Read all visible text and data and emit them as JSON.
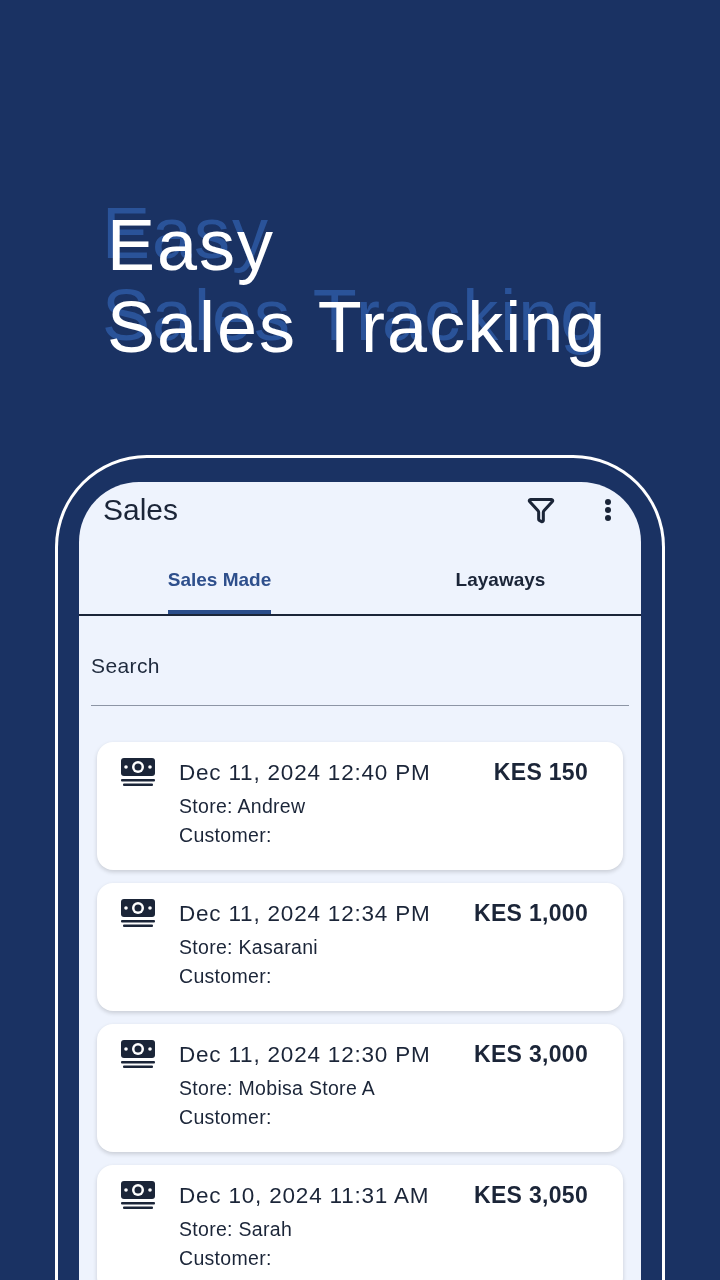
{
  "headline": {
    "lines": [
      "Easy",
      "Sales Tracking"
    ]
  },
  "app_bar": {
    "title": "Sales"
  },
  "tabs": [
    {
      "label": "Sales Made",
      "selected": true
    },
    {
      "label": "Layaways",
      "selected": false
    }
  ],
  "search": {
    "placeholder": "Search"
  },
  "sales": [
    {
      "datetime": "Dec 11, 2024 12:40 PM",
      "store": "Store: Andrew",
      "customer": "Customer:",
      "amount": "KES 150"
    },
    {
      "datetime": "Dec 11, 2024 12:34 PM",
      "store": "Store: Kasarani",
      "customer": "Customer:",
      "amount": "KES 1,000"
    },
    {
      "datetime": "Dec 11, 2024 12:30 PM",
      "store": "Store: Mobisa Store A",
      "customer": "Customer:",
      "amount": "KES 3,000"
    },
    {
      "datetime": "Dec 10, 2024 11:31 AM",
      "store": "Store: Sarah",
      "customer": "Customer:",
      "amount": "KES 3,050"
    }
  ]
}
